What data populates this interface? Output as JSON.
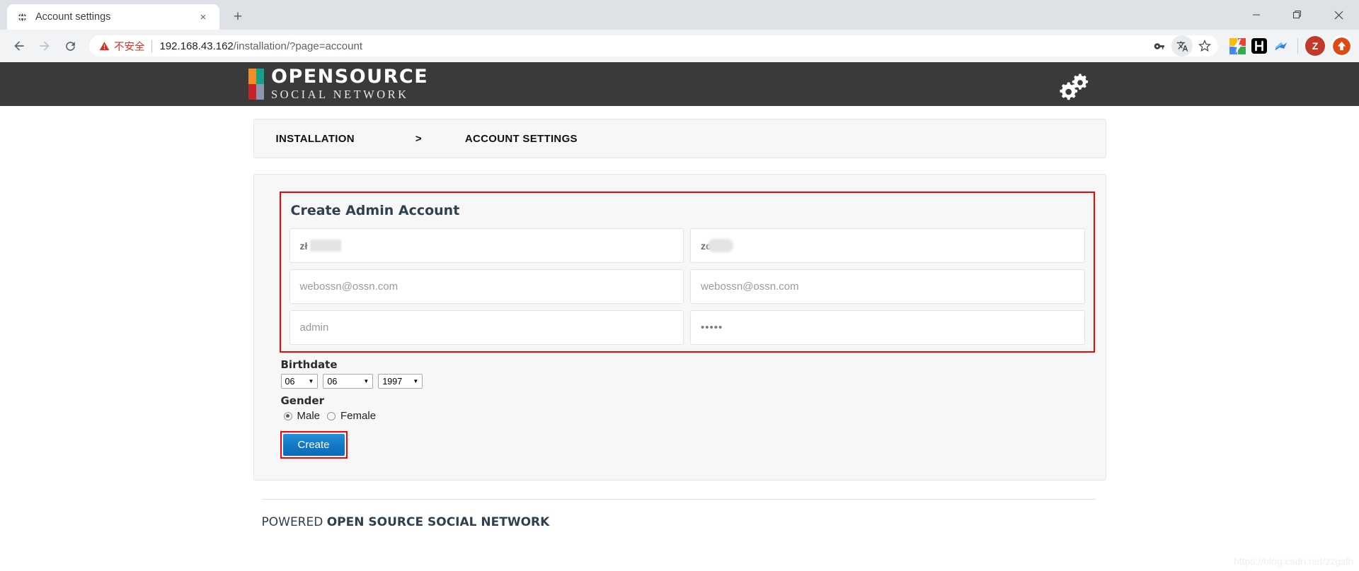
{
  "browser": {
    "tab": {
      "title": "Account settings",
      "favicon": "globe-icon",
      "close": "×"
    },
    "new_tab_label": "+",
    "window_controls": {
      "minimize": "—",
      "maximize": "❐",
      "close": "✕"
    },
    "nav": {
      "back": "←",
      "forward": "→",
      "reload": "⟳"
    },
    "omnibox": {
      "warning_icon": "warning-triangle-icon",
      "security_text": "不安全",
      "url_host": "192.168.43.162",
      "url_path": "/installation/?page=account",
      "full_url": "192.168.43.162/installation/?page=account",
      "actions": [
        "key-icon",
        "translate-icon",
        "bookmark-star-icon"
      ]
    },
    "extensions": [
      "extension-colorful-icon",
      "extension-h-icon",
      "extension-bird-icon"
    ],
    "profile": {
      "avatar_initial": "Z",
      "update_icon": "update-arrow-icon"
    }
  },
  "site": {
    "logo": {
      "main": "OPENSOURCE",
      "sub": "SOCIAL NETWORK",
      "block_colors": [
        "#ef8f23",
        "#15a08a",
        "#c8222a",
        "#8e95b0"
      ]
    },
    "settings_icon": "gears-icon",
    "header_bg": "#3a3a3a"
  },
  "breadcrumb": {
    "first": "INSTALLATION",
    "separator": ">",
    "second": "ACCOUNT SETTINGS"
  },
  "form": {
    "title": "Create Admin Account",
    "highlight_color": "#ff0000",
    "fields": {
      "first_name": {
        "value": "zł",
        "redacted": true
      },
      "last_name": {
        "value": "zc",
        "redacted": true
      },
      "email": {
        "placeholder": "webossn@ossn.com"
      },
      "email_confirm": {
        "placeholder": "webossn@ossn.com"
      },
      "username": {
        "placeholder": "admin"
      },
      "password": {
        "value": "•••••"
      }
    },
    "birthdate": {
      "label": "Birthdate",
      "month": "06",
      "day": "06",
      "year": "1997",
      "arrow": "▼"
    },
    "gender": {
      "label": "Gender",
      "male": "Male",
      "female": "Female",
      "selected": "Male"
    },
    "submit": {
      "label": "Create",
      "color": "#1277c4"
    }
  },
  "footer": {
    "powered": "POWERED",
    "brand": "OPEN SOURCE SOCIAL NETWORK"
  },
  "watermark": "https://blog.csdn.net/zzgslh"
}
